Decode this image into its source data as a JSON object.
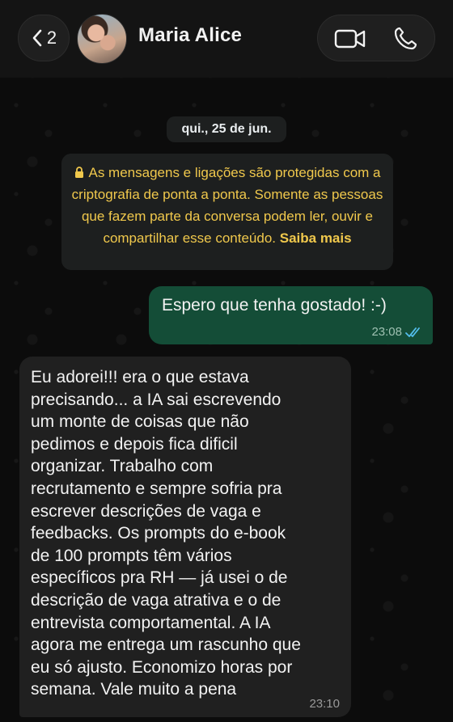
{
  "header": {
    "back_count": "2",
    "contact_name": "Maria Alice"
  },
  "chat": {
    "date": "qui., 25 de jun.",
    "encryption_notice": {
      "text": "As mensagens e ligações são protegidas com a criptografia de ponta a ponta. Somente as pessoas que fazem parte da conversa podem ler, ouvir e compartilhar esse conteúdo.",
      "link": "Saiba mais"
    },
    "messages": [
      {
        "direction": "outgoing",
        "text": "Espero que tenha gostado! :-)",
        "time": "23:08",
        "status": "read"
      },
      {
        "direction": "incoming",
        "text": "Eu adorei!!! era o que estava\nprecisando... a IA sai escrevendo\num monte de coisas que não\npedimos e depois fica dificil\norganizar. Trabalho com\nrecrutamento e sempre sofria pra\nescrever descrições de vaga e\nfeedbacks. Os prompts do e-book\nde 100 prompts têm vários\nespecíficos pra RH — já usei o de\ndescrição de vaga atrativa e o de\nentrevista comportamental. A IA\nagora me entrega um rascunho que\neu só ajusto. Economizo horas por\nsemana. Vale muito a pena",
        "time": "23:10"
      }
    ]
  },
  "colors": {
    "outgoing_bubble": "#144d37",
    "incoming_bubble": "#202020",
    "notice_text": "#f0c84c",
    "read_ticks": "#53bdeb"
  },
  "icons": [
    "chevron-left-icon",
    "video-camera-icon",
    "phone-icon",
    "lock-icon",
    "double-check-icon"
  ]
}
